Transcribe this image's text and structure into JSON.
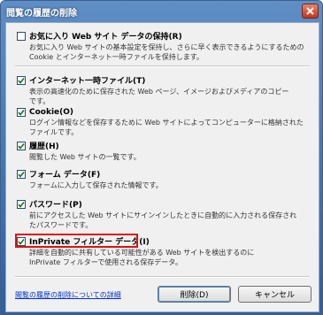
{
  "window": {
    "title": "閲覧の履歴の削除"
  },
  "options": [
    {
      "label": "お気に入り Web サイト データの保持(R)",
      "checked": false,
      "description": "お気に入り Web サイトの基本設定を保持し、さらに早く表示できるようにするための\nCookie とインターネット一時ファイルを保持します。"
    },
    {
      "label": "インターネット一時ファイル(T)",
      "checked": true,
      "description": "表示の高速化のために保存された Web ページ、イメージおよびメディアのコピー\nです。"
    },
    {
      "label": "Cookie(O)",
      "checked": true,
      "description": "ログイン情報などを保存するために Web サイトによってコンピューターに格納された\nファイルです。"
    },
    {
      "label": "履歴(H)",
      "checked": true,
      "description": "閲覧した Web サイトの一覧です。"
    },
    {
      "label": "フォーム データ(F)",
      "checked": true,
      "description": "フォームに入力して保存された情報です。"
    },
    {
      "label": "パスワード(P)",
      "checked": true,
      "description": "前にアクセスした Web サイトにサインインしたときに自動的に入力される保存され\nたパスワードです。"
    },
    {
      "label": "InPrivate フィルター データ(I)",
      "checked": true,
      "description": "詳細を自動的に共有している可能性がある Web サイトを検出するのに\nInPrivate フィルターで使用される保存データ。"
    }
  ],
  "footer": {
    "link": "閲覧の履歴の削除についての詳細",
    "delete_label": "削除(D)",
    "cancel_label": "キャンセル"
  },
  "colors": {
    "title_bar": "#2f5f9f",
    "highlight_border": "#e01010",
    "link": "#0033cc"
  }
}
